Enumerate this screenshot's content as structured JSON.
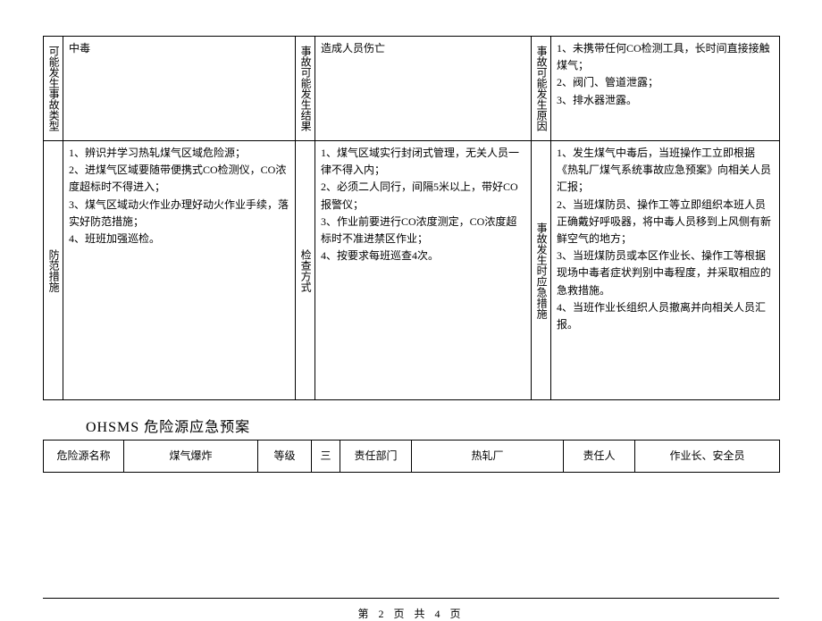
{
  "table1": {
    "row1": {
      "label1": "可能发生事故类型",
      "cell1": "中毒",
      "label2": "事故可能发生结果",
      "cell2": "造成人员伤亡",
      "label3": "事故可能发生原因",
      "cell3_lines": [
        "1、未携带任何CO检测工具，长时间直接接触煤气；",
        "2、阀门、管道泄露；",
        "3、排水器泄露。"
      ]
    },
    "row2": {
      "label1": "防范措施",
      "cell1_lines": [
        "1、辨识并学习热轧煤气区域危险源；",
        "2、进煤气区域要随带便携式CO检测仪，CO浓度超标时不得进入；",
        "3、煤气区域动火作业办理好动火作业手续，落实好防范措施；",
        "4、班班加强巡检。"
      ],
      "label2": "检查方式",
      "cell2_lines": [
        "1、煤气区域实行封闭式管理，无关人员一律不得入内；",
        "2、必须二人同行，间隔5米以上，带好CO报警仪；",
        "3、作业前要进行CO浓度测定，CO浓度超标时不准进禁区作业；",
        "4、按要求每班巡查4次。"
      ],
      "label3": "事故发生时应急措施",
      "cell3_lines": [
        "1、发生煤气中毒后，当班操作工立即根据《热轧厂煤气系统事故应急预案》向相关人员汇报；",
        "2、当班煤防员、操作工等立即组织本班人员正确戴好呼吸器，将中毒人员移到上风侧有新鲜空气的地方；",
        "3、当班煤防员或本区作业长、操作工等根据现场中毒者症状判别中毒程度，并采取相应的急救措施。",
        "4、当班作业长组织人员撤离并向相关人员汇报。"
      ]
    }
  },
  "section_title": "OHSMS 危险源应急预案",
  "table2": {
    "h1": "危险源名称",
    "v1": "煤气爆炸",
    "h2": "等级",
    "v2": "三",
    "h3": "责任部门",
    "v3": "热轧厂",
    "h4": "责任人",
    "v4": "作业长、安全员"
  },
  "page_footer": "第 2 页 共 4 页"
}
